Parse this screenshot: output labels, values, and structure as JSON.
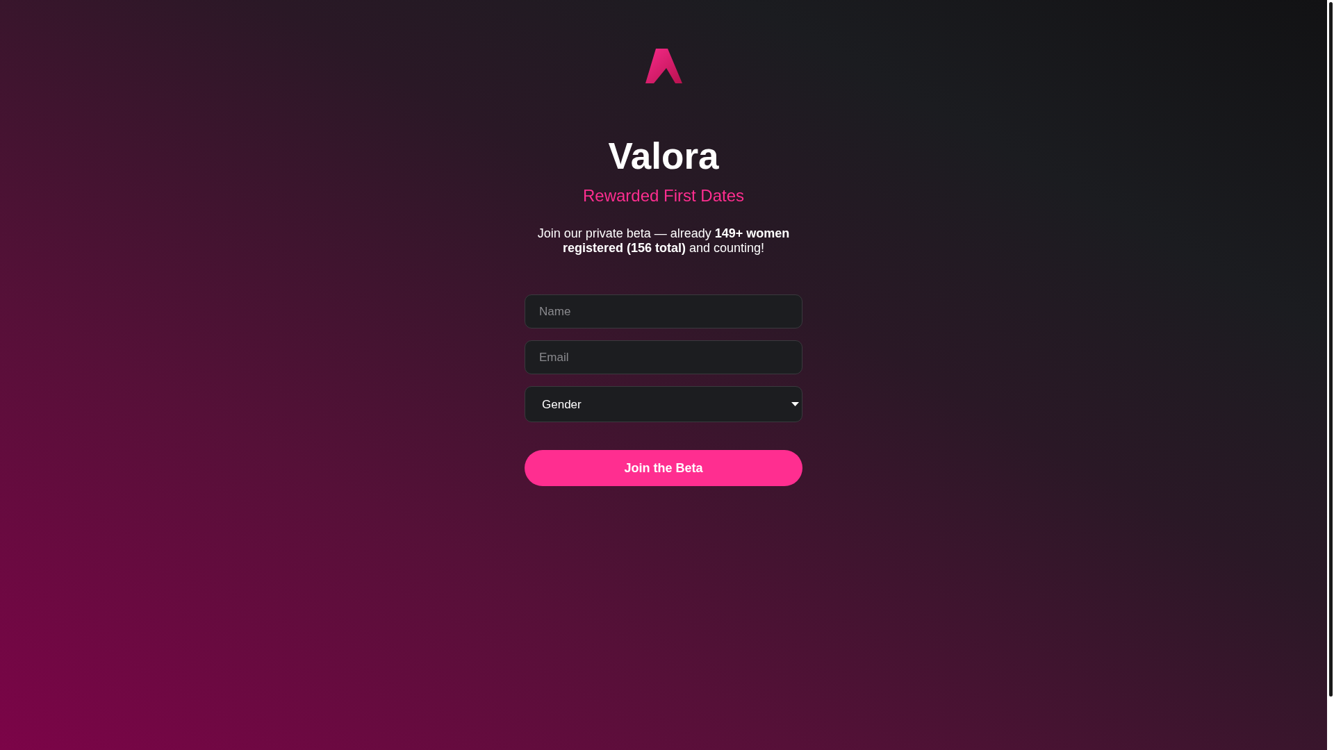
{
  "brand": {
    "title": "Valora",
    "tagline": "Rewarded First Dates"
  },
  "intro": "Join our private beta — already **149+ women registered (156 total)** and counting!",
  "form": {
    "fields": [
      {
        "kind": "text",
        "placeholder": "Name"
      },
      {
        "kind": "text",
        "placeholder": "Email"
      },
      {
        "kind": "select",
        "value": "Gender"
      }
    ],
    "submit": "Join the Beta"
  }
}
